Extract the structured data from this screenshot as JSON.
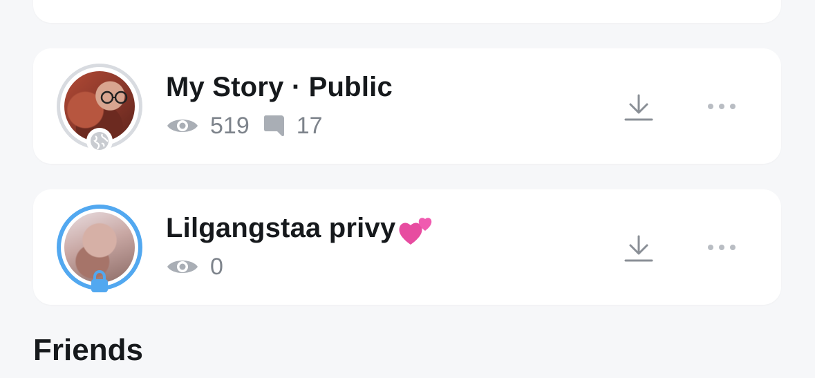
{
  "stories": [
    {
      "title": "My Story · Public",
      "views": "519",
      "replies": "17",
      "ring_color": "#d8dbe0",
      "badge": "globe-icon"
    },
    {
      "title": "Lilgangstaa privy",
      "title_emoji": "💕",
      "views": "0",
      "ring_color": "#52a8f0",
      "badge": "lock-icon"
    }
  ],
  "section": {
    "friends_label": "Friends"
  },
  "colors": {
    "background": "#f6f7f9",
    "card": "#ffffff",
    "text": "#16191c",
    "muted": "#7d838b",
    "private_accent": "#52a8f0",
    "top_ring": "#9b4ce0"
  }
}
